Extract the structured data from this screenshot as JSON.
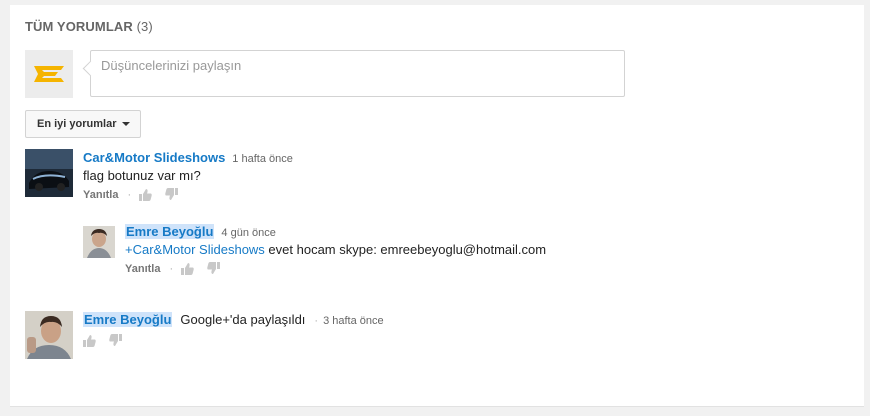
{
  "section": {
    "title": "TÜM YORUMLAR",
    "count": "(3)"
  },
  "share": {
    "placeholder": "Düşüncelerinizi paylaşın"
  },
  "sort": {
    "label": "En iyi yorumlar"
  },
  "actions": {
    "reply_label": "Yanıtla",
    "separator": "·"
  },
  "comments": [
    {
      "author": "Car&Motor Slideshows",
      "time": "1 hafta önce",
      "text": "flag botunuz var mı?"
    }
  ],
  "replies": [
    {
      "author": "Emre Beyoğlu",
      "time": "4 gün önce",
      "mention": "+Car&Motor Slideshows",
      "text": " evet hocam skype: emreebeyoglu@hotmail.com"
    }
  ],
  "share_post": {
    "author": "Emre Beyoğlu",
    "text": "Google+'da paylaşıldı",
    "separator": "·",
    "time": "3 hafta önce"
  },
  "colors": {
    "link": "#167ac6",
    "logo": "#f5b400",
    "highlight": "#cfe3fa"
  },
  "icons": [
    "logo-icon",
    "thumbs-up-icon",
    "thumbs-down-icon",
    "caret-down-icon"
  ]
}
